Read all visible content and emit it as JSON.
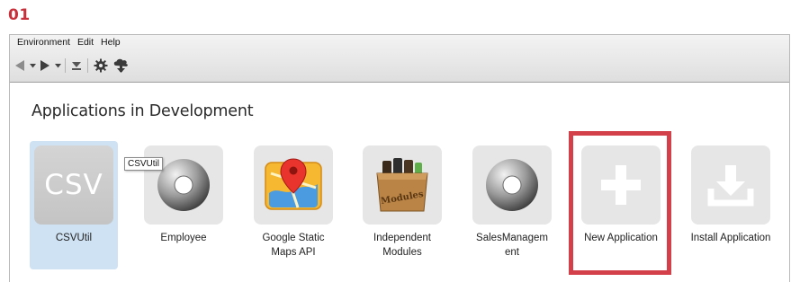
{
  "step_number": "01",
  "menubar": {
    "items": [
      "Environment",
      "Edit",
      "Help"
    ]
  },
  "toolbar": {
    "icons": [
      "back-arrow-icon",
      "back-dropdown-icon",
      "forward-arrow-icon",
      "forward-dropdown-icon",
      "download-icon",
      "gear-icon",
      "cloud-deploy-icon"
    ]
  },
  "section": {
    "title": "Applications in Development"
  },
  "apps": [
    {
      "label": "CSVUtil",
      "icon": "csv-icon",
      "icon_text": "CSV",
      "selected": true
    },
    {
      "label": "Employee",
      "icon": "disc-icon"
    },
    {
      "label": "Google Static Maps API",
      "icon": "map-pin-icon"
    },
    {
      "label": "Independent Modules",
      "icon": "modules-box-icon",
      "icon_text": "Modules"
    },
    {
      "label": "SalesManagement",
      "icon": "disc-icon"
    },
    {
      "label": "New Application",
      "icon": "plus-icon"
    },
    {
      "label": "Install Application",
      "icon": "install-download-icon"
    }
  ],
  "tooltip": {
    "text": "CSVUtil"
  },
  "colors": {
    "highlight": "#d3404a",
    "step_number": "#c8313c",
    "selected_tile": "#cfe2f3"
  }
}
